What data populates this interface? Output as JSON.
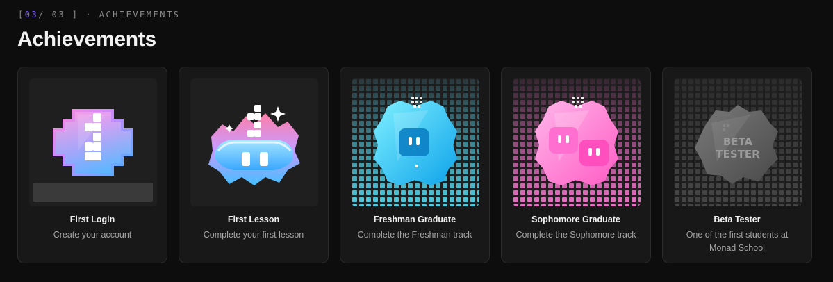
{
  "section": {
    "eyebrow_open": "[",
    "eyebrow_index": "03",
    "eyebrow_rest": "/ 03 ] · ACHIEVEMENTS",
    "title": "Achievements"
  },
  "achievements": [
    {
      "name": "First Login",
      "description": "Create your account",
      "badge_icon": "pink-blue-cross-badge-icon"
    },
    {
      "name": "First Lesson",
      "description": "Complete your first lesson",
      "badge_icon": "pink-blue-cloud-badge-icon"
    },
    {
      "name": "Freshman Graduate",
      "description": "Complete the Freshman track",
      "badge_icon": "cyan-graduate-badge-icon",
      "accent": "#39d2ff"
    },
    {
      "name": "Sophomore Graduate",
      "description": "Complete the Sophomore track",
      "badge_icon": "pink-graduate-badge-icon",
      "accent": "#ff6fd0"
    },
    {
      "name": "Beta Tester",
      "description": "One of the first students at Monad School",
      "badge_icon": "gray-beta-tester-badge-icon",
      "badge_text": "BETA TESTER",
      "badge_text_line1": "BETA",
      "badge_text_line2": "TESTER"
    }
  ]
}
